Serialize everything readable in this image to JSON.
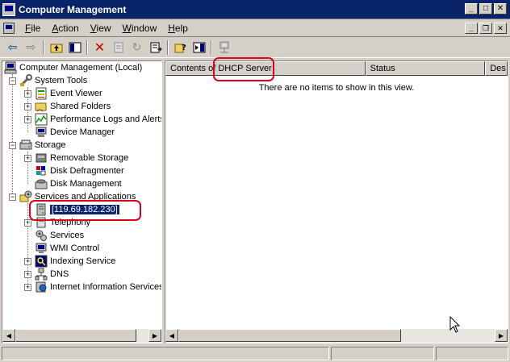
{
  "window": {
    "title": "Computer Management"
  },
  "menu": [
    {
      "key": "F",
      "rest": "ile"
    },
    {
      "key": "A",
      "rest": "ction"
    },
    {
      "key": "V",
      "rest": "iew"
    },
    {
      "key": "W",
      "rest": "indow"
    },
    {
      "key": "H",
      "rest": "elp"
    }
  ],
  "tree": {
    "root": "Computer Management (Local)",
    "system_tools": "System Tools",
    "event_viewer": "Event Viewer",
    "shared_folders": "Shared Folders",
    "perf_logs": "Performance Logs and Alerts",
    "device_manager": "Device Manager",
    "storage": "Storage",
    "removable_storage": "Removable Storage",
    "disk_defrag": "Disk Defragmenter",
    "disk_mgmt": "Disk Management",
    "services_apps": "Services and Applications",
    "dhcp_server": "[119.69.182.230]",
    "telephony": "Telephony",
    "services": "Services",
    "wmi": "WMI Control",
    "indexing": "Indexing Service",
    "dns": "DNS",
    "iis": "Internet Information Services"
  },
  "list": {
    "columns": [
      "Contents of DHCP Server",
      "Status",
      "Des"
    ],
    "empty_message": "There are no items to show in this view."
  },
  "colors": {
    "titlebar": "#0a246a",
    "face": "#d4d0c8",
    "annotation": "#e0001a"
  }
}
